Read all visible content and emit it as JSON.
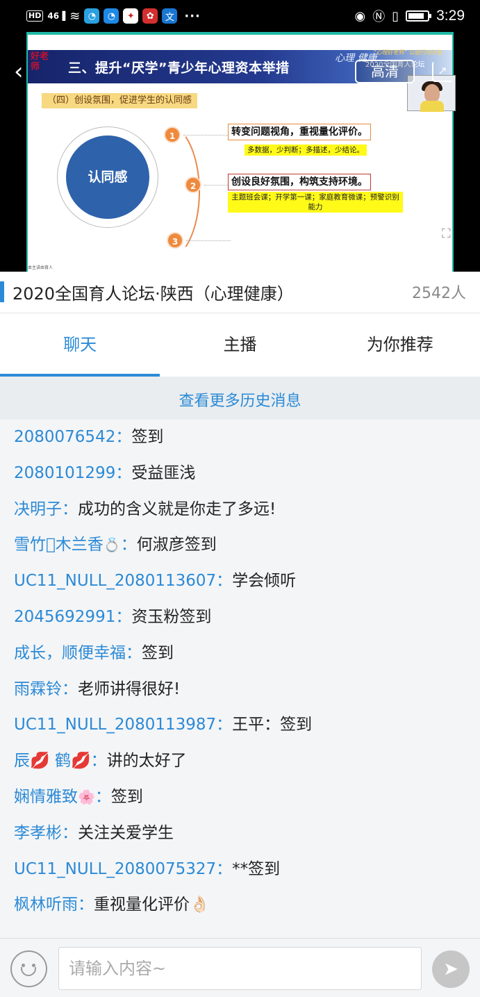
{
  "status_bar": {
    "hd": "HD",
    "signal": "46",
    "time": "3:29",
    "dots": "···"
  },
  "video": {
    "quality_label": "高清",
    "slide": {
      "logo": "好老师",
      "section_title": "三、提升“厌学”青少年心理资本举措",
      "brand": "心理 健康",
      "event_top": "“心理好老师” 公益行动计划",
      "event_main": "2020全国育人论坛",
      "subheading": "（四）创设氛围，促进学生的认同感",
      "center_label": "认同感",
      "points": [
        {
          "num": "1",
          "title": "转变问题视角，重视量化评价。",
          "detail": "多数据，少判断；多描述，少结论。"
        },
        {
          "num": "2",
          "title": "创设良好氛围，构筑支持环境。",
          "detail": "主题班会课；开学第一课；家庭教育微课；预警识别能力"
        },
        {
          "num": "3",
          "title": "",
          "detail": ""
        }
      ],
      "footer": "本主讲由育人"
    }
  },
  "room": {
    "title": "2020全国育人论坛·陕西（心理健康）",
    "viewers": "2542人"
  },
  "tabs": [
    {
      "label": "聊天",
      "active": true
    },
    {
      "label": "主播",
      "active": false
    },
    {
      "label": "为你推荐",
      "active": false
    }
  ],
  "history_label": "查看更多历史消息",
  "messages": [
    {
      "name": "2080076542",
      "text": "签到"
    },
    {
      "name": "2080101299",
      "text": "受益匪浅"
    },
    {
      "name": "决明子",
      "text": "成功的含义就是你走了多远!"
    },
    {
      "name": "雪竹\u0000木兰香",
      "emoji": "💍",
      "text": "何淑彦签到"
    },
    {
      "name": "UC11_NULL_2080113607",
      "text": "学会倾听"
    },
    {
      "name": "2045692991",
      "text": "资玉粉签到"
    },
    {
      "name": "成长，顺便幸福",
      "text": "签到"
    },
    {
      "name": "雨霖铃",
      "text": "老师讲得很好!"
    },
    {
      "name": "UC11_NULL_2080113987",
      "text": "王平：签到"
    },
    {
      "name": "辰💋 鹤💋",
      "text": "讲的太好了"
    },
    {
      "name": "娴情雅致",
      "emoji": "🌸",
      "text": "签到"
    },
    {
      "name": "李孝彬",
      "text": "关注关爱学生"
    },
    {
      "name": "UC11_NULL_2080075327",
      "text": "**签到"
    },
    {
      "name": "枫林听雨",
      "text": "重视量化评价👌🏻"
    }
  ],
  "input": {
    "placeholder": "请输入内容~",
    "send_icon": "send-icon",
    "emoji_icon": "smile-icon"
  }
}
